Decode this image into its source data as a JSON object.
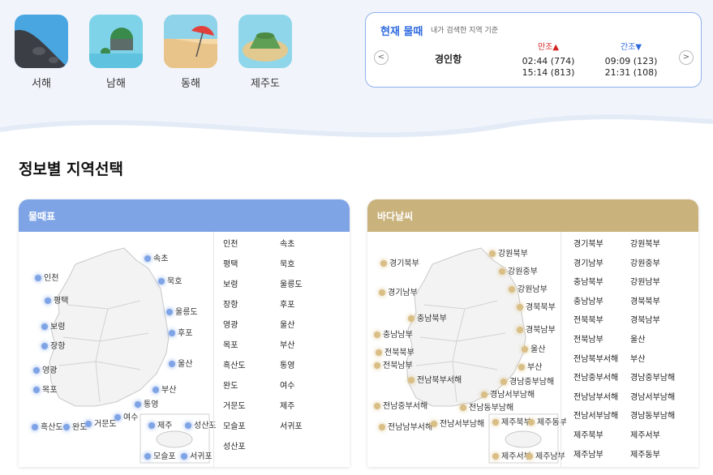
{
  "seas": [
    {
      "label": "서해",
      "icon": "west-sea-icon"
    },
    {
      "label": "남해",
      "icon": "south-sea-icon"
    },
    {
      "label": "동해",
      "icon": "east-sea-icon"
    },
    {
      "label": "제주도",
      "icon": "jeju-icon"
    }
  ],
  "tide": {
    "title": "현재 물때",
    "subtitle": "내가 검색한 지역 기준",
    "port": "경인항",
    "prev_symbol": "<",
    "next_symbol": ">",
    "high": {
      "label": "만조▲",
      "times": [
        "02:44 (774)",
        "15:14 (813)"
      ]
    },
    "low": {
      "label": "간조▼",
      "times": [
        "09:09 (123)",
        "21:31 (108)"
      ]
    }
  },
  "section_title": "정보별 지역선택",
  "tide_table": {
    "header": "물때표",
    "color": "#7fa4e6",
    "list": [
      [
        "인천",
        "속초"
      ],
      [
        "평택",
        "묵호"
      ],
      [
        "보령",
        "울릉도"
      ],
      [
        "장항",
        "후포"
      ],
      [
        "영광",
        "울산"
      ],
      [
        "목포",
        "부산"
      ],
      [
        "흑산도",
        "통영"
      ],
      [
        "완도",
        "여수"
      ],
      [
        "거문도",
        "제주"
      ],
      [
        "모슬포",
        "서귀포"
      ],
      [
        "성산포",
        ""
      ]
    ],
    "map_labels": [
      "속초",
      "묵호",
      "인천",
      "울릉도",
      "평택",
      "후포",
      "보령",
      "장항",
      "울산",
      "영광",
      "부산",
      "목포",
      "통영",
      "여수",
      "흑산도",
      "완도",
      "거문도",
      "제주",
      "성산포",
      "모슬포",
      "서귀포"
    ]
  },
  "sea_weather": {
    "header": "바다날씨",
    "color": "#c9b27c",
    "list": [
      [
        "경기북부",
        "강원북부"
      ],
      [
        "경기남부",
        "강원중부"
      ],
      [
        "충남북부",
        "강원남부"
      ],
      [
        "충남남부",
        "경북북부"
      ],
      [
        "전북북부",
        "경북남부"
      ],
      [
        "전북남부",
        "울산"
      ],
      [
        "전남북부서해",
        "부산"
      ],
      [
        "전남중부서해",
        "경남중부남해"
      ],
      [
        "전남남부서해",
        "경남서부남해"
      ],
      [
        "전남서부남해",
        "경남동부남해"
      ],
      [
        "제주북부",
        "제주서부"
      ],
      [
        "제주남부",
        "제주동부"
      ]
    ],
    "map_labels": [
      "강원북부",
      "경기북부",
      "강원중부",
      "경기남부",
      "강원남부",
      "충남북부",
      "경북북부",
      "충남남부",
      "경북남부",
      "전북북부",
      "울산",
      "전북남부",
      "전남북부서해",
      "부산",
      "경남중부남해",
      "경남서부남해",
      "전남중부서해",
      "전남동부남해",
      "전남남부서해",
      "전남서부남해",
      "제주북부",
      "제주동부",
      "제주서부",
      "제주남부"
    ]
  }
}
